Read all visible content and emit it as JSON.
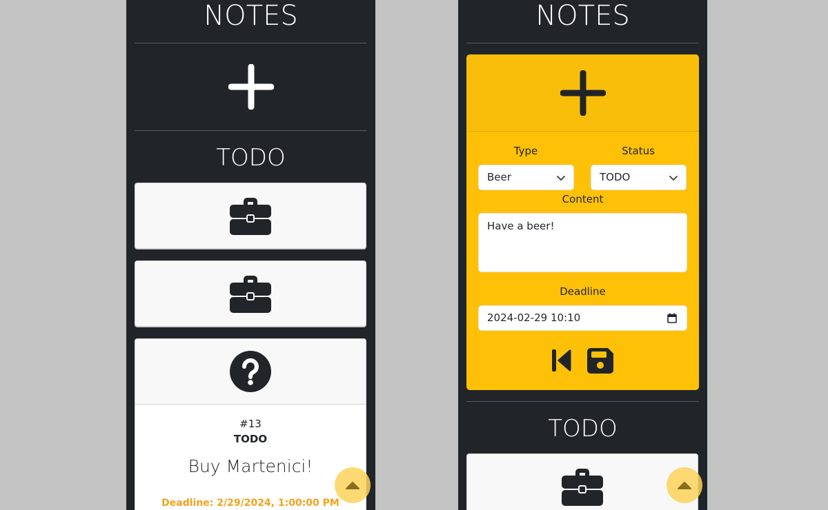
{
  "left_screen": {
    "app_title": "NOTES",
    "section_title": "TODO",
    "note": {
      "id": "#13",
      "status": "TODO",
      "content": "Buy Martenici!",
      "deadline": "Deadline: 2/29/2024, 1:00:00 PM"
    }
  },
  "right_screen": {
    "app_title": "NOTES",
    "section_title": "TODO",
    "form": {
      "type_label": "Type",
      "type_value": "Beer",
      "status_label": "Status",
      "status_value": "TODO",
      "content_label": "Content",
      "content_value": "Have a beer!",
      "deadline_label": "Deadline",
      "deadline_value": "2024-02-29 10:10"
    }
  },
  "colors": {
    "background": "#c4c4c4",
    "app_bg": "#212529",
    "form_accent": "#ffc107",
    "deadline_text": "#f4a21a",
    "scroll_button": "#fdd25a"
  },
  "icons": [
    "plus-icon",
    "briefcase-icon",
    "question-circle-icon",
    "chevron-down-icon",
    "calendar-icon",
    "skip-back-icon",
    "save-icon",
    "caret-up-icon"
  ]
}
